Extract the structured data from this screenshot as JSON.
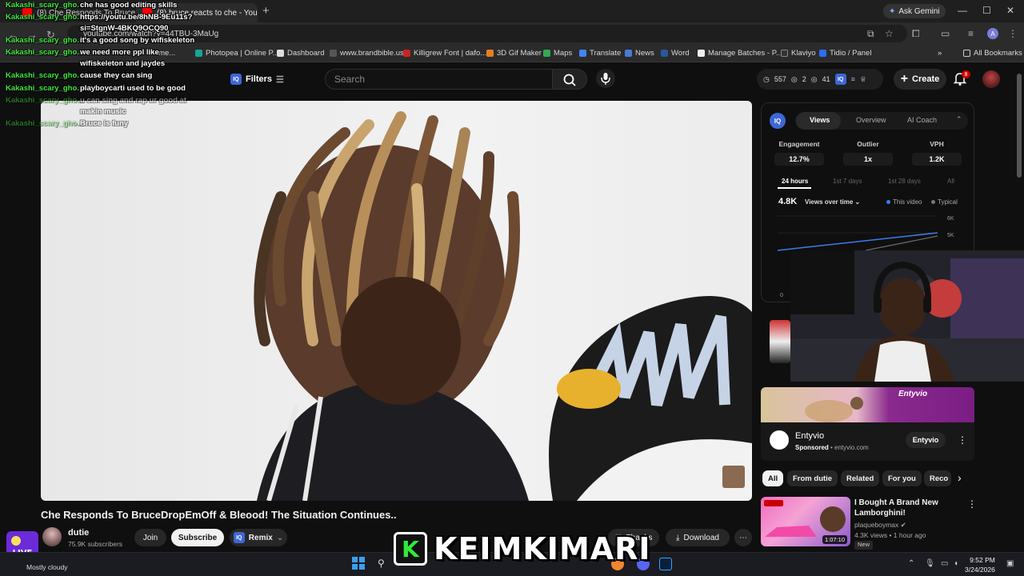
{
  "browser": {
    "tabs": [
      {
        "title": "(8) Che Responds To Bruce",
        "close": "×"
      },
      {
        "title": "(8) bruce reacts to che - YouTub",
        "close": "×"
      }
    ],
    "new_tab": "+",
    "ask_gemini": "Ask Gemini",
    "url": "youtube.com/watch?v=44TBU-3MaUg",
    "profile_initial": "A",
    "bookmarks": [
      "Home...",
      "Photopea | Online P...",
      "Dashboard",
      "www.brandbible.us",
      "Killigrew Font | dafo...",
      "3D Gif Maker",
      "Maps",
      "Translate",
      "News",
      "Word",
      "Manage Batches - P...",
      "Klaviyo",
      "Tidio / Panel"
    ],
    "all_bookmarks": "All Bookmarks"
  },
  "yt_header": {
    "filters_label": "Filters",
    "iq": "IQ",
    "search_placeholder": "Search",
    "stats": {
      "a": "557",
      "b": "2",
      "c": "41"
    },
    "create_label": "Create",
    "notif_count": "8"
  },
  "video": {
    "title": "Che Responds To BruceDropEmOff & Bleood! The Situation Continues..",
    "channel": "dutie",
    "subscribers": "75.9K subscribers",
    "join": "Join",
    "subscribe": "Subscribe",
    "remix": "Remix",
    "thanks": "Thanks",
    "download": "Download"
  },
  "iq_panel": {
    "tabs": [
      "Views",
      "Overview",
      "AI Coach"
    ],
    "metrics": [
      {
        "label": "Engagement",
        "value": "12.7%"
      },
      {
        "label": "Outlier",
        "value": "1x"
      },
      {
        "label": "VPH",
        "value": "1.2K"
      }
    ],
    "ranges": [
      "24 hours",
      "1st 7 days",
      "1st 28 days",
      "All"
    ],
    "views_total": "4.8K",
    "views_over_time": "Views over time",
    "legend_this": "This video",
    "legend_typical": "Typical",
    "y_labels": [
      "6K",
      "5K",
      "0"
    ]
  },
  "ad": {
    "brand_banner": "Entyvio",
    "title": "Entyvio",
    "sponsored": "Sponsored",
    "domain": "entyvio.com",
    "button": "Entyvio"
  },
  "chips": [
    "All",
    "From dutie",
    "Related",
    "For you",
    "Reco"
  ],
  "recommendation": {
    "title": "I Bought A Brand New Lamborghini!",
    "channel": "plaqueboymax",
    "meta": "4.3K views • 1 hour ago",
    "badge": "New",
    "duration": "1:07:10"
  },
  "chat": [
    {
      "user": "Kakashi_scary_gho...",
      "msg": "che has good editing skills"
    },
    {
      "user": "Kakashi_scary_gho...",
      "msg": "https://youtu.be/8hNB-9Eu11s?"
    },
    {
      "user": "",
      "msg": "si=StgnW-4BKQ9OCQ90"
    },
    {
      "user": "Kakashi_scary_gho...",
      "msg": "it's a good song by wifiskeleton"
    },
    {
      "user": "Kakashi_scary_gho...",
      "msg": "we need more ppl like"
    },
    {
      "user": "",
      "msg": "wifiskeleton and jaydes"
    },
    {
      "user": "Kakashi_scary_gho...",
      "msg": "cause they can sing"
    },
    {
      "user": "Kakashi_scary_gho...",
      "msg": "playboycarti used to be good"
    },
    {
      "user": "Kakashi_scary_gho...",
      "msg": "u can sing and rap ur good at"
    },
    {
      "user": "",
      "msg": "makin music"
    },
    {
      "user": "Kakashi_scary_gho...",
      "msg": "Bruce is funy"
    }
  ],
  "taskbar": {
    "weather": "Mostly cloudy",
    "time": "9:52 PM",
    "date": "3/24/2026"
  },
  "branding": {
    "logo_letter": "K",
    "streamer_name": "KEIMKIMARI",
    "live_text": "LIVE"
  }
}
